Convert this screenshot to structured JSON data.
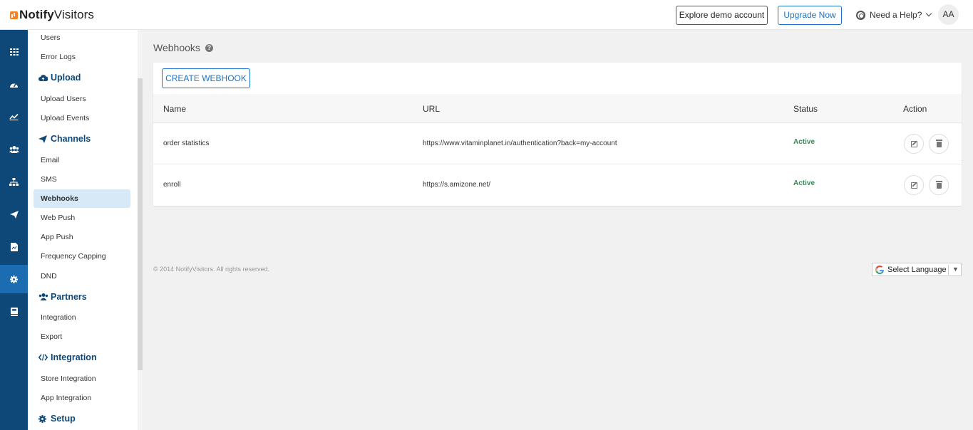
{
  "header": {
    "brand_bold": "Notify",
    "brand_rest": "Visitors",
    "explore_label": "Explore demo account",
    "upgrade_label": "Upgrade Now",
    "help_label": "Need a Help?",
    "avatar_initials": "AA"
  },
  "rail": {
    "icons": [
      "grid-icon",
      "dashboard-icon",
      "analytics-icon",
      "users-icon",
      "sitemap-icon",
      "send-icon",
      "report-icon",
      "settings-icon",
      "book-icon"
    ],
    "active_index": 7
  },
  "submenu": {
    "users": "Users",
    "error_logs": "Error Logs",
    "upload_head": "Upload",
    "upload_users": "Upload Users",
    "upload_events": "Upload Events",
    "channels_head": "Channels",
    "email": "Email",
    "sms": "SMS",
    "webhooks": "Webhooks",
    "web_push": "Web Push",
    "app_push": "App Push",
    "frequency_capping": "Frequency Capping",
    "dnd": "DND",
    "partners_head": "Partners",
    "integration": "Integration",
    "export": "Export",
    "integration_head": "Integration",
    "store_integration": "Store Integration",
    "app_integration": "App Integration",
    "setup_head": "Setup"
  },
  "main": {
    "title": "Webhooks",
    "help_mark": "?",
    "create_label": "CREATE WEBHOOK",
    "columns": {
      "name": "Name",
      "url": "URL",
      "status": "Status",
      "action": "Action"
    },
    "rows": [
      {
        "name": "order statistics",
        "url": "https://www.vitaminplanet.in/authentication?back=my-account",
        "status": "Active"
      },
      {
        "name": "enroll",
        "url": "https://s.amizone.net/",
        "status": "Active"
      }
    ]
  },
  "footer": {
    "copyright": "© 2014 NotifyVisitors. All rights reserved.",
    "language_label": "Select Language"
  },
  "colors": {
    "rail_bg": "#0e4878",
    "rail_active": "#1b6cb0",
    "accent": "#1a73c9",
    "brand_orange": "#f58220",
    "status_active": "#2e8b57"
  }
}
